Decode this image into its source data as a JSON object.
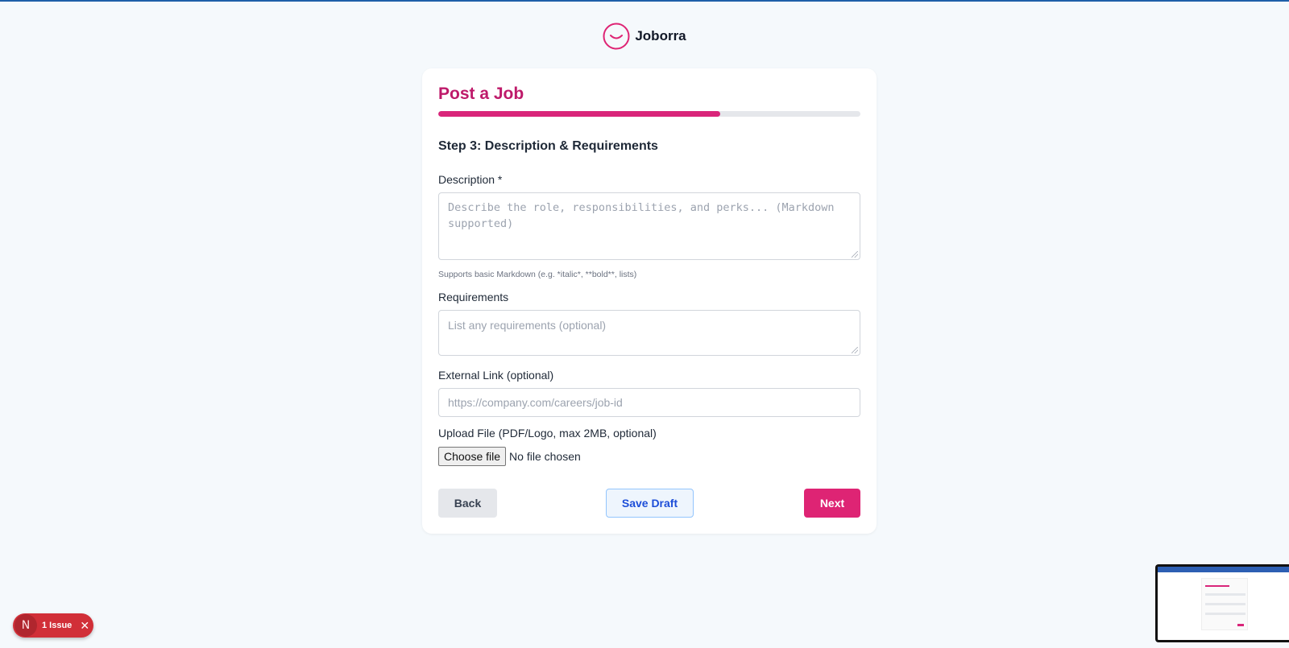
{
  "brand": {
    "name": "Joborra",
    "logo_icon": "smile-icon",
    "accent": "#de2474"
  },
  "page": {
    "title": "Post a Job",
    "progress_percent": 66.7,
    "step_title": "Step 3: Description & Requirements"
  },
  "form": {
    "description": {
      "label": "Description *",
      "placeholder": "Describe the role, responsibilities, and perks... (Markdown supported)",
      "value": "",
      "hint": "Supports basic Markdown (e.g. *italic*, **bold**, lists)"
    },
    "requirements": {
      "label": "Requirements",
      "placeholder": "List any requirements (optional)",
      "value": ""
    },
    "external_link": {
      "label": "External Link (optional)",
      "placeholder": "https://company.com/careers/job-id",
      "value": ""
    },
    "upload": {
      "label": "Upload File (PDF/Logo, max 2MB, optional)",
      "button_label": "Choose file",
      "status": "No file chosen"
    }
  },
  "actions": {
    "back_label": "Back",
    "save_draft_label": "Save Draft",
    "next_label": "Next"
  },
  "dev_overlay": {
    "logo_letter": "N",
    "issues_label": "1 Issue",
    "close_icon": "close-icon"
  }
}
